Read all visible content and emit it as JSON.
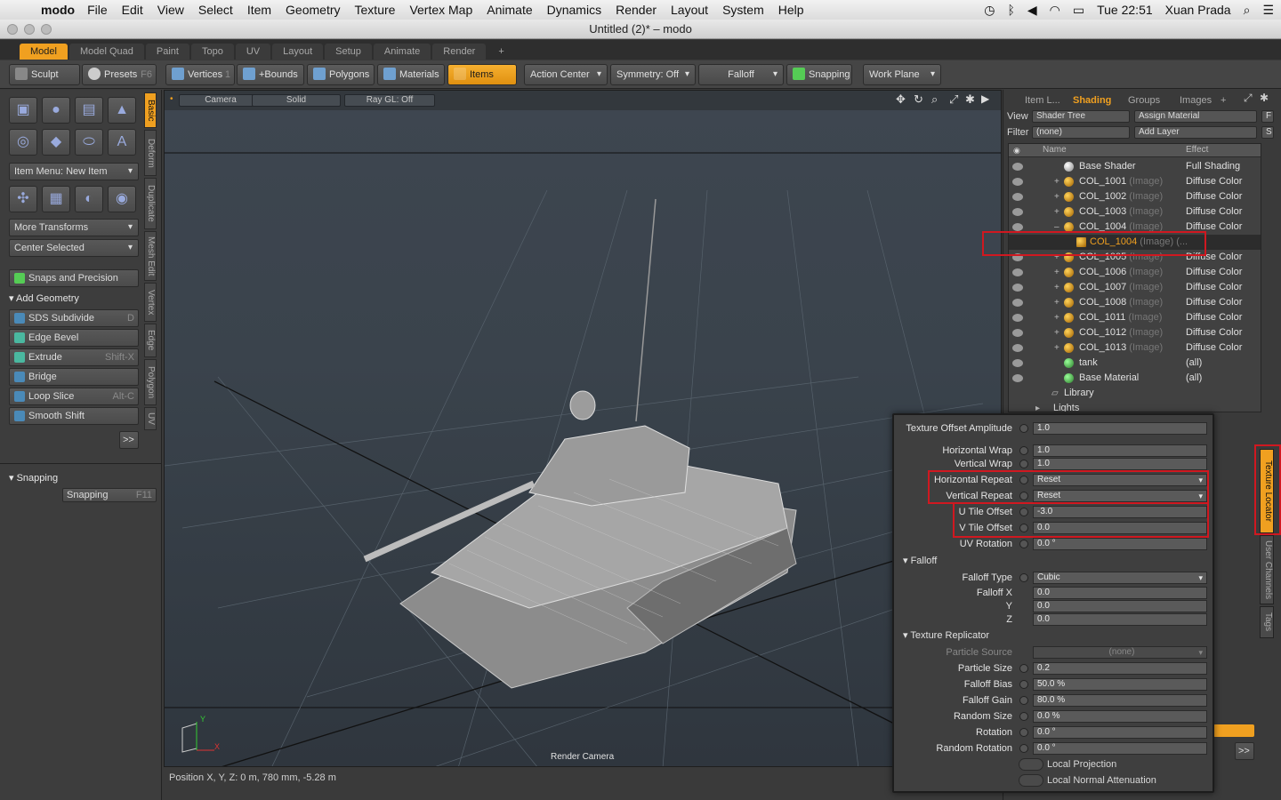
{
  "menubar": {
    "app": "modo",
    "items": [
      "File",
      "Edit",
      "View",
      "Select",
      "Item",
      "Geometry",
      "Texture",
      "Vertex Map",
      "Animate",
      "Dynamics",
      "Render",
      "Layout",
      "System",
      "Help"
    ],
    "clock": "Tue 22:51",
    "user": "Xuan Prada"
  },
  "window": {
    "title": "Untitled (2)* – modo"
  },
  "layout_tabs": [
    "Model",
    "Model Quad",
    "Paint",
    "Topo",
    "UV",
    "Layout",
    "Setup",
    "Animate",
    "Render",
    "+"
  ],
  "toolbar": {
    "sculpt": "Sculpt",
    "presets": "Presets",
    "presets_key": "F6",
    "vertices": "Vertices",
    "vertices_num": "1",
    "bounds": "+Bounds",
    "polygons": "Polygons",
    "materials": "Materials",
    "items": "Items",
    "action_center": "Action Center",
    "symmetry": "Symmetry: Off",
    "falloff": "Falloff",
    "snapping": "Snapping",
    "work_plane": "Work Plane"
  },
  "left": {
    "item_menu": "Item Menu: New Item",
    "more_transforms": "More Transforms",
    "center_selected": "Center Selected",
    "snaps_precision": "Snaps and Precision",
    "add_geometry": "Add Geometry",
    "tools": [
      {
        "label": "SDS Subdivide",
        "key": "D"
      },
      {
        "label": "Edge Bevel",
        "key": ""
      },
      {
        "label": "Extrude",
        "key": "Shift-X"
      },
      {
        "label": "Bridge",
        "key": ""
      },
      {
        "label": "Loop Slice",
        "key": "Alt-C"
      },
      {
        "label": "Smooth Shift",
        "key": ""
      }
    ],
    "more": ">>",
    "snapping_section": "Snapping",
    "snapping_btn": "Snapping",
    "snapping_key": "F11",
    "vtabs": [
      "Basic",
      "Deform",
      "Duplicate",
      "Mesh Edit",
      "Vertex",
      "Edge",
      "Polygon",
      "UV"
    ]
  },
  "viewport": {
    "camera": "Camera",
    "shading": "Solid",
    "raygl": "Ray GL: Off",
    "render_camera": "Render Camera",
    "axis_x": "X",
    "axis_y": "Y",
    "axis_z": "Z"
  },
  "status": {
    "position": "Position X, Y, Z:   0 m, 780 mm, -5.28 m"
  },
  "right": {
    "tabs": [
      "Item L...",
      "Shading",
      "Groups",
      "Images",
      "+"
    ],
    "view_label": "View",
    "view_value": "Shader Tree",
    "assign_material": "Assign Material",
    "assign_key": "F",
    "filter_label": "Filter",
    "filter_value": "(none)",
    "add_layer": "Add Layer",
    "add_key": "S",
    "col_name": "Name",
    "col_effect": "Effect",
    "rows": [
      {
        "name": "Base Shader",
        "sub": "",
        "effect": "Full Shading"
      },
      {
        "name": "COL_1001",
        "sub": "(Image)",
        "effect": "Diffuse Color"
      },
      {
        "name": "COL_1002",
        "sub": "(Image)",
        "effect": "Diffuse Color"
      },
      {
        "name": "COL_1003",
        "sub": "(Image)",
        "effect": "Diffuse Color"
      },
      {
        "name": "COL_1004",
        "sub": "(Image)",
        "effect": "Diffuse Color"
      },
      {
        "name": "COL_1004",
        "sub": "(Image) (...",
        "effect": ""
      },
      {
        "name": "COL_1005",
        "sub": "(Image)",
        "effect": "Diffuse Color"
      },
      {
        "name": "COL_1006",
        "sub": "(Image)",
        "effect": "Diffuse Color"
      },
      {
        "name": "COL_1007",
        "sub": "(Image)",
        "effect": "Diffuse Color"
      },
      {
        "name": "COL_1008",
        "sub": "(Image)",
        "effect": "Diffuse Color"
      },
      {
        "name": "COL_1011",
        "sub": "(Image)",
        "effect": "Diffuse Color"
      },
      {
        "name": "COL_1012",
        "sub": "(Image)",
        "effect": "Diffuse Color"
      },
      {
        "name": "COL_1013",
        "sub": "(Image)",
        "effect": "Diffuse Color"
      },
      {
        "name": "tank",
        "sub": "",
        "effect": "(all)"
      },
      {
        "name": "Base Material",
        "sub": "",
        "effect": "(all)"
      },
      {
        "name": "Library",
        "sub": "",
        "effect": ""
      },
      {
        "name": "Lights",
        "sub": "",
        "effect": ""
      }
    ],
    "side_tabs": [
      "Texture Locator",
      "User Channels",
      "Tags"
    ],
    "more": ">>"
  },
  "props": {
    "texture_offset_amplitude": {
      "label": "Texture Offset Amplitude",
      "value": "1.0"
    },
    "horizontal_wrap": {
      "label": "Horizontal Wrap",
      "value": "1.0"
    },
    "vertical_wrap": {
      "label": "Vertical Wrap",
      "value": "1.0"
    },
    "horizontal_repeat": {
      "label": "Horizontal Repeat",
      "value": "Reset"
    },
    "vertical_repeat": {
      "label": "Vertical Repeat",
      "value": "Reset"
    },
    "u_tile_offset": {
      "label": "U Tile Offset",
      "value": "-3.0"
    },
    "v_tile_offset": {
      "label": "V Tile Offset",
      "value": "0.0"
    },
    "uv_rotation": {
      "label": "UV Rotation",
      "value": "0.0 °"
    },
    "falloff_section": "Falloff",
    "falloff_type": {
      "label": "Falloff Type",
      "value": "Cubic"
    },
    "falloff_x": {
      "label": "Falloff X",
      "value": "0.0"
    },
    "falloff_y": {
      "label": "Y",
      "value": "0.0"
    },
    "falloff_z": {
      "label": "Z",
      "value": "0.0"
    },
    "replicator_section": "Texture Replicator",
    "particle_source": {
      "label": "Particle Source",
      "value": "(none)"
    },
    "particle_size": {
      "label": "Particle Size",
      "value": "0.2"
    },
    "falloff_bias": {
      "label": "Falloff Bias",
      "value": "50.0 %"
    },
    "falloff_gain": {
      "label": "Falloff Gain",
      "value": "80.0 %"
    },
    "random_size": {
      "label": "Random Size",
      "value": "0.0 %"
    },
    "rotation": {
      "label": "Rotation",
      "value": "0.0 °"
    },
    "random_rotation": {
      "label": "Random Rotation",
      "value": "0.0 °"
    },
    "local_projection": "Local Projection",
    "local_normal": "Local Normal Attenuation"
  },
  "colors": {
    "accent": "#f0a020",
    "highlight_box": "#d01820"
  }
}
